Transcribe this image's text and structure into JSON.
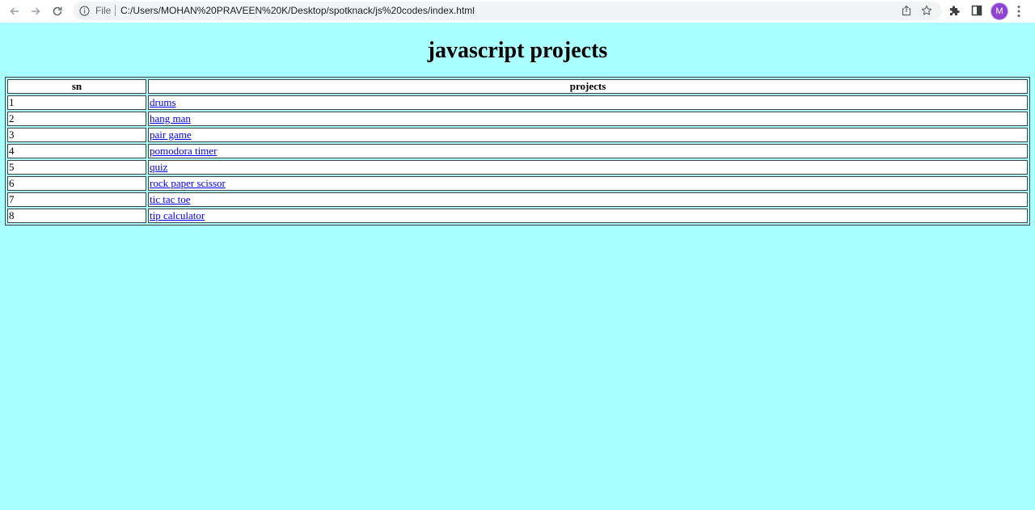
{
  "browser": {
    "scheme_label": "File",
    "url": "C:/Users/MOHAN%20PRAVEEN%20K/Desktop/spotknack/js%20codes/index.html",
    "avatar_letter": "M",
    "icons": [
      "back-arrow-icon",
      "forward-arrow-icon",
      "reload-icon",
      "info-icon",
      "share-icon",
      "star-icon",
      "puzzle-extension-icon",
      "side-panel-icon",
      "kebab-menu-icon"
    ]
  },
  "page": {
    "background": "#aaffff",
    "link_color": "#0000ee",
    "heading": "javascript projects",
    "table": {
      "headers": [
        "sn",
        "projects"
      ],
      "rows": [
        {
          "sn": "1",
          "project": "drums"
        },
        {
          "sn": "2",
          "project": "hang man"
        },
        {
          "sn": "3",
          "project": "pair game"
        },
        {
          "sn": "4",
          "project": "pomodora timer"
        },
        {
          "sn": "5",
          "project": "quiz"
        },
        {
          "sn": "6",
          "project": "rock paper scissor"
        },
        {
          "sn": "7",
          "project": "tic tac toe"
        },
        {
          "sn": "8",
          "project": "tip calculator"
        }
      ]
    }
  }
}
